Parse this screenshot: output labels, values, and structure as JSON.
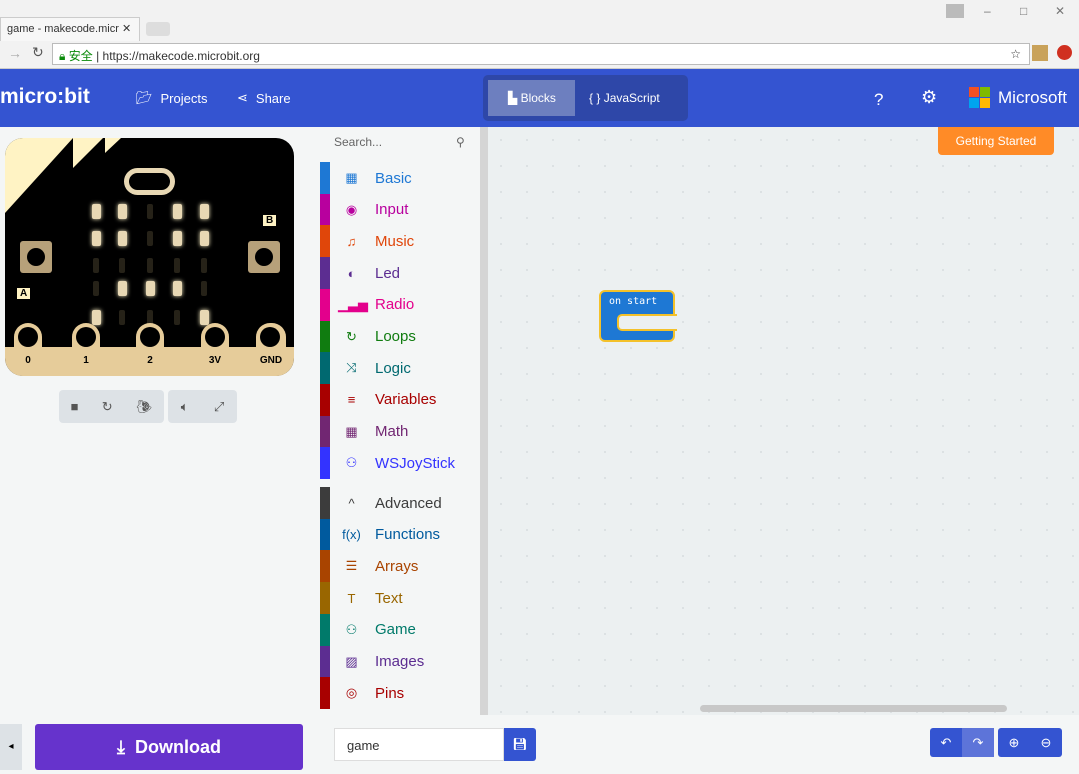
{
  "browser": {
    "tab_title": "game - makecode.micr",
    "url": "https://makecode.microbit.org",
    "secure_label": "安全"
  },
  "header": {
    "logo": "micro:bit",
    "projects": "Projects",
    "share": "Share",
    "blocks": "Blocks",
    "javascript": "JavaScript",
    "microsoft": "Microsoft",
    "getting_started": "Getting Started"
  },
  "simulator": {
    "leds": [
      [
        1,
        1,
        0,
        1,
        1
      ],
      [
        1,
        1,
        0,
        1,
        1
      ],
      [
        0,
        0,
        0,
        0,
        0
      ],
      [
        0,
        1,
        1,
        1,
        0
      ],
      [
        1,
        0,
        0,
        0,
        1
      ]
    ],
    "pins": [
      "0",
      "1",
      "2",
      "3V",
      "GND"
    ],
    "button_a": "A",
    "button_b": "B"
  },
  "toolbox": {
    "search_placeholder": "Search...",
    "categories": [
      {
        "label": "Basic",
        "icon": "grid",
        "color": "#1e78d4"
      },
      {
        "label": "Input",
        "icon": "◉",
        "color": "#b8009e"
      },
      {
        "label": "Music",
        "icon": "♫",
        "color": "#e0460a"
      },
      {
        "label": "Led",
        "icon": "◐",
        "color": "#5c2d91"
      },
      {
        "label": "Radio",
        "icon": "▁▃▅",
        "color": "#e3008c"
      },
      {
        "label": "Loops",
        "icon": "↻",
        "color": "#107c10"
      },
      {
        "label": "Logic",
        "icon": "⤨",
        "color": "#006970"
      },
      {
        "label": "Variables",
        "icon": "≡",
        "color": "#a80000"
      },
      {
        "label": "Math",
        "icon": "▦",
        "color": "#712672"
      },
      {
        "label": "WSJoyStick",
        "icon": "⚇",
        "color": "#3333ff"
      }
    ],
    "advanced": [
      {
        "label": "Advanced",
        "icon": "^",
        "color": "#3c3c3c"
      },
      {
        "label": "Functions",
        "icon": "f(x)",
        "color": "#005a9e"
      },
      {
        "label": "Arrays",
        "icon": "☰",
        "color": "#a94400"
      },
      {
        "label": "Text",
        "icon": "T",
        "color": "#996600"
      },
      {
        "label": "Game",
        "icon": "⚇",
        "color": "#007a6a"
      },
      {
        "label": "Images",
        "icon": "▨",
        "color": "#5c2d91"
      },
      {
        "label": "Pins",
        "icon": "◎",
        "color": "#a80000"
      }
    ]
  },
  "workspace": {
    "block_label": "on start"
  },
  "footer": {
    "download": "Download",
    "project_name": "game"
  }
}
